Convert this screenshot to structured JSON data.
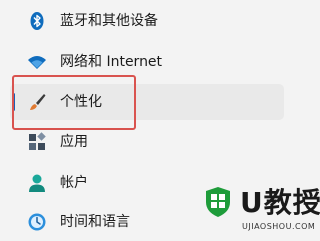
{
  "nav": {
    "items": [
      {
        "label": "蓝牙和其他设备",
        "icon": "bluetooth-icon"
      },
      {
        "label": "网络和 Internet",
        "icon": "wifi-icon"
      },
      {
        "label": "个性化",
        "icon": "paintbrush-icon",
        "selected": true
      },
      {
        "label": "应用",
        "icon": "apps-icon"
      },
      {
        "label": "帐户",
        "icon": "account-icon"
      },
      {
        "label": "时间和语言",
        "icon": "time-language-icon"
      }
    ]
  },
  "colors": {
    "accent": "#1a5fb4",
    "highlight_border": "#d9534f",
    "watermark_green": "#1e9c3a"
  },
  "watermark": {
    "brand": "U教授",
    "url": "UJIAOSHOU.COM"
  }
}
